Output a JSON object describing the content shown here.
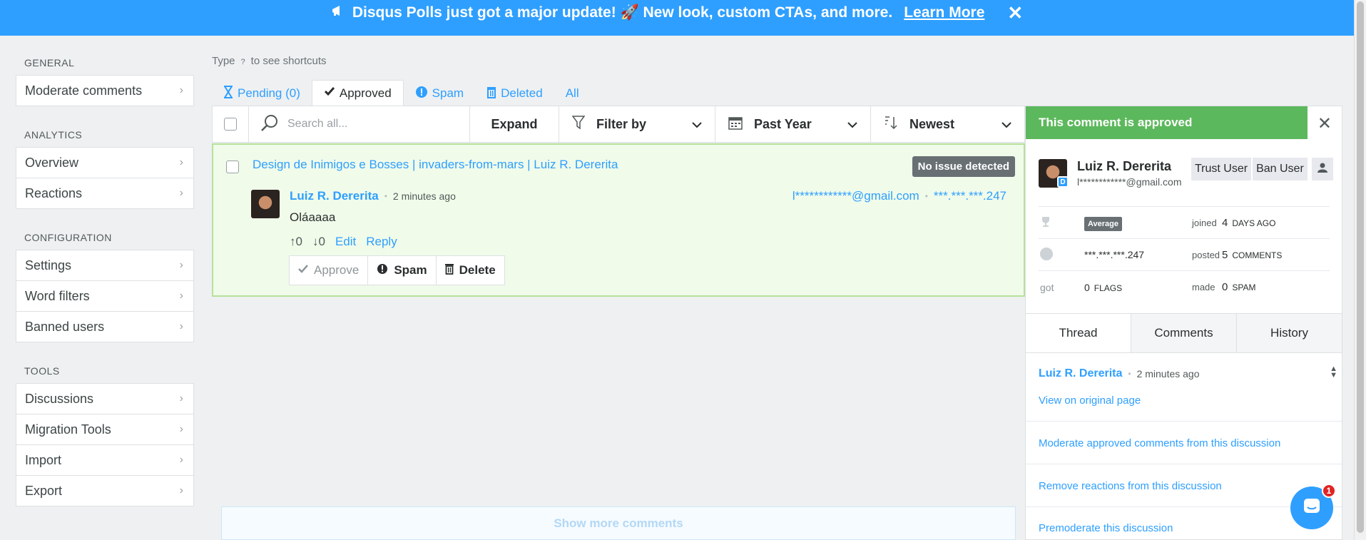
{
  "banner": {
    "text": "Disqus Polls just got a major update! 🚀 New look, custom CTAs, and more.",
    "link": "Learn More",
    "close": "✕"
  },
  "sidebar": {
    "sections": [
      {
        "title": "GENERAL",
        "items": [
          "Moderate comments"
        ]
      },
      {
        "title": "ANALYTICS",
        "items": [
          "Overview",
          "Reactions"
        ]
      },
      {
        "title": "CONFIGURATION",
        "items": [
          "Settings",
          "Word filters",
          "Banned users"
        ]
      },
      {
        "title": "TOOLS",
        "items": [
          "Discussions",
          "Migration Tools",
          "Import",
          "Export"
        ]
      }
    ]
  },
  "shortcut_hint": {
    "before": "Type",
    "key": "?",
    "after": "to see shortcuts"
  },
  "tabs": {
    "pending": "Pending (0)",
    "approved": "Approved",
    "spam": "Spam",
    "deleted": "Deleted",
    "all": "All"
  },
  "toolbar": {
    "search_placeholder": "Search all...",
    "expand": "Expand",
    "filter": "Filter by",
    "range": "Past Year",
    "sort": "Newest"
  },
  "comment": {
    "thread_title": "Design de Inimigos e Bosses | invaders-from-mars | Luiz R. Dererita",
    "status": "No issue detected",
    "author": "Luiz R. Dererita",
    "time": "2 minutes ago",
    "email": "l************@gmail.com",
    "ip": "***.***.***.247",
    "text": "Oláaaaa",
    "upvotes": "0",
    "downvotes": "0",
    "edit": "Edit",
    "reply": "Reply",
    "approve": "Approve",
    "spam": "Spam",
    "delete": "Delete"
  },
  "show_more": "Show more comments",
  "panel": {
    "status": "This comment is approved",
    "close": "✕",
    "name": "Luiz R. Dererita",
    "email": "l************@gmail.com",
    "trust": "Trust User",
    "ban": "Ban User",
    "rank": "Average",
    "joined_label": "joined",
    "joined_value": "4",
    "joined_unit": "DAYS AGO",
    "ip": "***.***.***.247",
    "posted_label": "posted",
    "posted_value": "5",
    "posted_unit": "COMMENTS",
    "got_label": "got",
    "flags_value": "0",
    "flags_unit": "FLAGS",
    "made_label": "made",
    "spam_value": "0",
    "spam_unit": "SPAM",
    "tabs": [
      "Thread",
      "Comments",
      "History"
    ],
    "thread_author": "Luiz R. Dererita",
    "thread_time": "2 minutes ago",
    "view_original": "View on original page",
    "action_1": "Moderate approved comments from this discussion",
    "action_2": "Remove reactions from this discussion",
    "action_3": "Premoderate this discussion"
  },
  "chat": {
    "badge": "1"
  },
  "colors": {
    "accent": "#2e9fff",
    "approved": "#5cb85c",
    "comment_bg": "#f0fbea"
  }
}
